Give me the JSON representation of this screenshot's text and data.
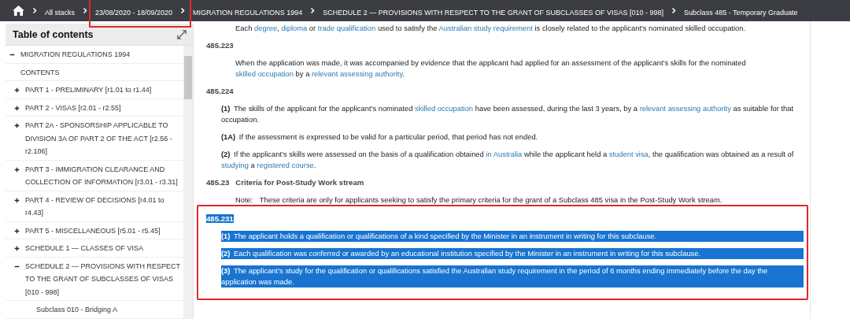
{
  "breadcrumb": [
    {
      "label": "All stacks",
      "annotated": false
    },
    {
      "label": "23/08/2020 - 18/09/2020",
      "annotated": true
    },
    {
      "label": "MIGRATION REGULATIONS 1994",
      "annotated": false
    },
    {
      "label": "SCHEDULE 2 — PROVISIONS WITH RESPECT TO THE GRANT OF SUBCLASSES OF VISAS [010 - 998]",
      "annotated": false
    },
    {
      "label": "Subclass 485 - Temporary Graduate",
      "annotated": false
    }
  ],
  "toc": {
    "title": "Table of contents",
    "items": [
      {
        "label": "MIGRATION REGULATIONS 1994",
        "expanded": true,
        "children": [
          {
            "label": "CONTENTS"
          },
          {
            "label": "PART 1 - PRELIMINARY [r1.01 to r1.44]",
            "expanded": false
          },
          {
            "label": "PART 2 - VISAS [r2.01 - r2.55]",
            "expanded": false
          },
          {
            "label": "PART 2A - SPONSORSHIP APPLICABLE TO DIVISION 3A OF PART 2 OF THE ACT [r2.56 - r2.106]",
            "expanded": false
          },
          {
            "label": "PART 3 - IMMIGRATION CLEARANCE AND COLLECTION OF INFORMATION [r3.01 - r3.31]",
            "expanded": false
          },
          {
            "label": "PART 4 - REVIEW OF DECISIONS [r4.01 to r4.43]",
            "expanded": false
          },
          {
            "label": "PART 5 - MISCELLANEOUS [r5.01 - r5.45]",
            "expanded": false
          },
          {
            "label": "SCHEDULE 1 — CLASSES OF VISA",
            "expanded": false
          },
          {
            "label": "SCHEDULE 2 — PROVISIONS WITH RESPECT TO THE GRANT OF SUBCLASSES OF VISAS [010 - 998]",
            "expanded": true,
            "children": [
              {
                "label": "Subclass 010 - Bridging A"
              }
            ]
          }
        ]
      }
    ]
  },
  "sections": [
    {
      "annotated": false,
      "blocks": [
        {
          "kind": "text",
          "selected": false,
          "segments": [
            {
              "text": "Each ",
              "link": false
            },
            {
              "text": "degree",
              "link": true
            },
            {
              "text": ", ",
              "link": false
            },
            {
              "text": "diploma",
              "link": true
            },
            {
              "text": " or ",
              "link": false
            },
            {
              "text": "trade qualification",
              "link": true
            },
            {
              "text": " used to satisfy the ",
              "link": false
            },
            {
              "text": "Australian study requirement",
              "link": true
            },
            {
              "text": " is closely related to the applicant's nominated skilled occupation.",
              "link": false
            }
          ]
        },
        {
          "kind": "heading",
          "selected": false,
          "number": "485.223"
        },
        {
          "kind": "text",
          "selected": false,
          "segments": [
            {
              "text": "When the application was made, it was accompanied by evidence that the applicant had applied for an assessment of the applicant’s skills for the nominated ",
              "link": false
            },
            {
              "text": "skilled occupation",
              "link": true
            },
            {
              "text": " by a ",
              "link": false
            },
            {
              "text": "relevant assessing authority",
              "link": true
            },
            {
              "text": "."
            }
          ]
        },
        {
          "kind": "heading",
          "selected": false,
          "number": "485.224"
        },
        {
          "kind": "subclause",
          "selected": false,
          "label": "(1)",
          "segments": [
            {
              "text": "The skills of the applicant for the applicant’s nominated ",
              "link": false
            },
            {
              "text": "skilled occupation",
              "link": true
            },
            {
              "text": " have been assessed, during the last 3 years, by a ",
              "link": false
            },
            {
              "text": "relevant assessing authority",
              "link": true
            },
            {
              "text": " as suitable for that occupation.",
              "link": false
            }
          ]
        },
        {
          "kind": "subclause",
          "selected": false,
          "label": "(1A)",
          "segments": [
            {
              "text": "If the assessment is expressed to be valid for a particular period, that period has not ended.",
              "link": false
            }
          ]
        },
        {
          "kind": "subclause",
          "selected": false,
          "label": "(2)",
          "segments": [
            {
              "text": "If the applicant’s skills were assessed on the basis of a qualification obtained ",
              "link": false
            },
            {
              "text": "in Australia",
              "link": true
            },
            {
              "text": " while the applicant held a ",
              "link": false
            },
            {
              "text": "student visa",
              "link": true
            },
            {
              "text": ", the qualification was obtained as a result of ",
              "link": false
            },
            {
              "text": "studying",
              "link": true
            },
            {
              "text": " a ",
              "link": false
            },
            {
              "text": "registered course",
              "link": true
            },
            {
              "text": "."
            }
          ]
        },
        {
          "kind": "heading",
          "selected": false,
          "number": "485.23",
          "title": "Criteria for Post-Study Work stream"
        },
        {
          "kind": "note",
          "selected": false,
          "label": "Note:",
          "segments": [
            {
              "text": "These criteria are only for applicants seeking to satisfy the primary criteria for the grant of a Subclass 485 visa in the Post-Study Work stream.",
              "link": false
            }
          ]
        }
      ]
    },
    {
      "annotated": true,
      "blocks": [
        {
          "kind": "heading",
          "selected": true,
          "number": "485.231"
        },
        {
          "kind": "subclause",
          "selected": true,
          "label": "(1)",
          "segments": [
            {
              "text": "The applicant holds a qualification or qualifications of a kind specified by the Minister in an instrument in writing for this subclause.",
              "link": false
            }
          ]
        },
        {
          "kind": "subclause",
          "selected": true,
          "label": "(2)",
          "segments": [
            {
              "text": "Each qualification was conferred or awarded by an educational institution specified by the Minister in an instrument in writing for this subclause.",
              "link": false
            }
          ]
        },
        {
          "kind": "subclause",
          "selected": true,
          "label": "(3)",
          "segments": [
            {
              "text": "The applicant’s study for the qualification or qualifications satisfied the Australian study requirement in the period of 6 months ending immediately before the day the application was made.",
              "link": false
            }
          ]
        }
      ]
    }
  ]
}
